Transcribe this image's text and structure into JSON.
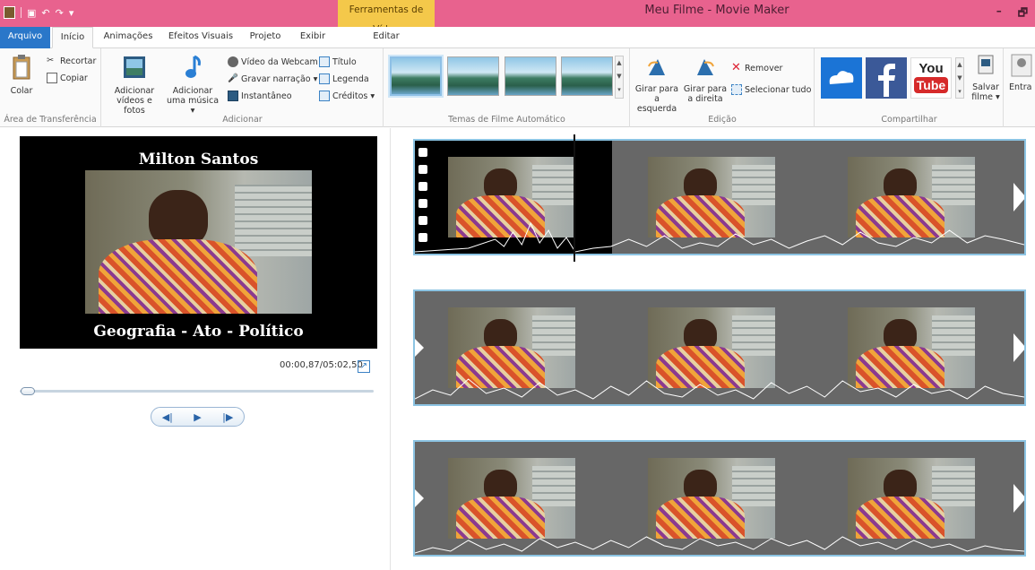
{
  "titlebar": {
    "tools_tab_head": "Ferramentas de Vídeo",
    "window_title": "Meu Filme - Movie Maker",
    "minimize": "–",
    "restore": "🗗"
  },
  "tabs": [
    "Arquivo",
    "Início",
    "Animações",
    "Efeitos Visuais",
    "Projeto",
    "Exibir",
    "Editar"
  ],
  "ribbon": {
    "clipboard": {
      "paste": "Colar",
      "cut": "Recortar",
      "copy": "Copiar",
      "label": "Área de Transferência"
    },
    "add": {
      "add_videos_l1": "Adicionar",
      "add_videos_l2": "vídeos e fotos",
      "add_music_l1": "Adicionar",
      "add_music_l2": "uma música ▾",
      "webcam": "Vídeo da Webcam",
      "narration": "Gravar narração ▾",
      "snapshot": "Instantâneo",
      "title": "Título",
      "caption": "Legenda",
      "credits": "Créditos ▾",
      "label": "Adicionar"
    },
    "themes": {
      "label": "Temas de Filme Automático"
    },
    "editing": {
      "rotate_left_l1": "Girar para",
      "rotate_left_l2": "a esquerda",
      "rotate_right_l1": "Girar para",
      "rotate_right_l2": "a direita",
      "remove": "Remover",
      "select_all": "Selecionar tudo",
      "label": "Edição"
    },
    "share": {
      "youtube_l1": "You",
      "youtube_l2": "Tube",
      "save_l1": "Salvar",
      "save_l2": "filme ▾",
      "enter": "Entra",
      "label": "Compartilhar"
    }
  },
  "preview": {
    "title_text": "Milton Santos",
    "caption_text": "Geografia - Ato - Político",
    "time": "00:00,87/05:02,50",
    "seek_position": 0.003
  },
  "colors": {
    "title_bar": "#e8628e",
    "file_tab": "#2a77c9",
    "tools_tab": "#f4c84a",
    "storyboard_border": "#8cc4e3"
  }
}
